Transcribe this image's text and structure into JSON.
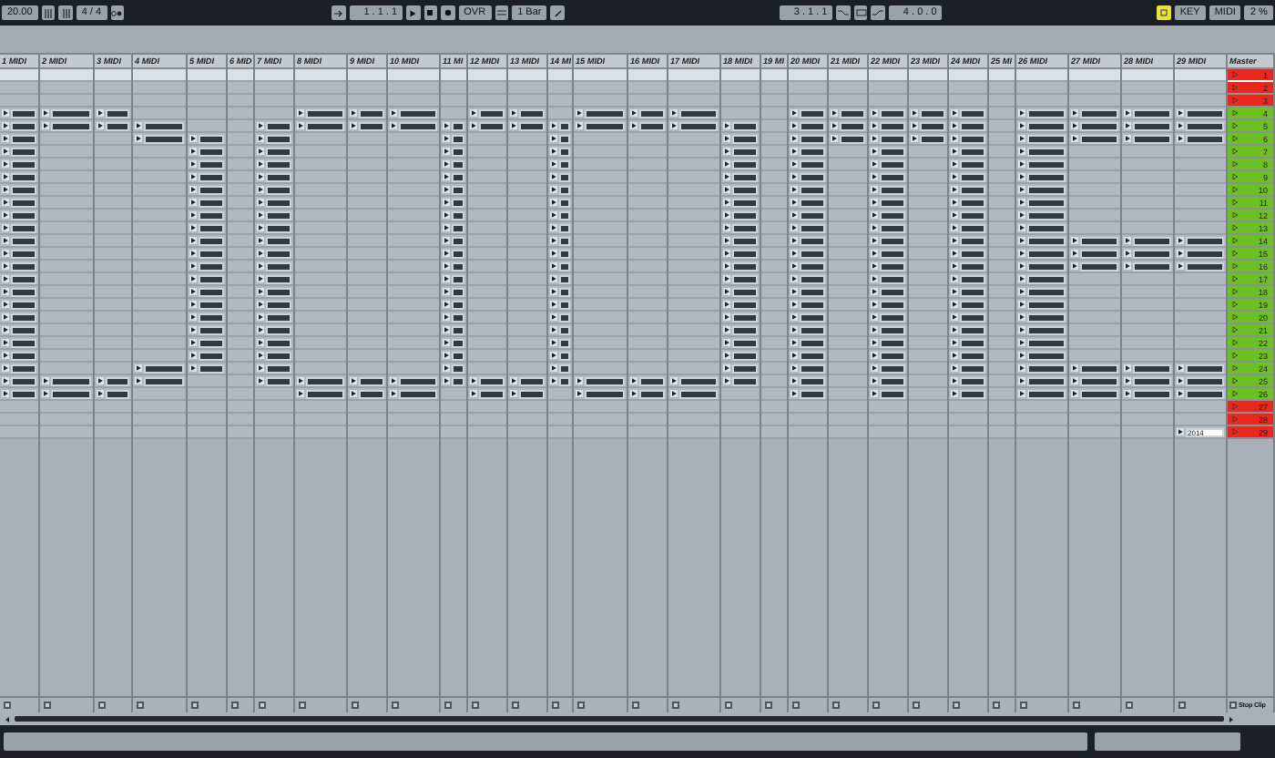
{
  "transport": {
    "tempo": "20.00",
    "time_signature": "4 / 4",
    "position": "1 . 1 . 1",
    "overdub": "OVR",
    "quantize": "1 Bar",
    "loop_start": "3 . 1 . 1",
    "loop_length": "4 . 0 . 0",
    "key": "KEY",
    "midi": "MIDI",
    "cpu": "2 %"
  },
  "tracks": [
    {
      "name": "1 MIDI",
      "clip_slots": [
        false,
        false,
        false,
        true,
        true,
        true,
        true,
        true,
        true,
        true,
        true,
        true,
        true,
        true,
        true,
        true,
        true,
        true,
        true,
        true,
        true,
        true,
        true,
        true,
        true,
        true,
        false,
        false,
        false
      ]
    },
    {
      "name": "2 MIDI",
      "clip_slots": [
        false,
        false,
        false,
        true,
        true,
        false,
        false,
        false,
        false,
        false,
        false,
        false,
        false,
        false,
        false,
        false,
        false,
        false,
        false,
        false,
        false,
        false,
        false,
        false,
        true,
        true,
        false,
        false,
        false
      ]
    },
    {
      "name": "3 MIDI",
      "clip_slots": [
        false,
        false,
        false,
        true,
        true,
        false,
        false,
        false,
        false,
        false,
        false,
        false,
        false,
        false,
        false,
        false,
        false,
        false,
        false,
        false,
        false,
        false,
        false,
        false,
        true,
        true,
        false,
        false,
        false
      ]
    },
    {
      "name": "4 MIDI",
      "clip_slots": [
        false,
        false,
        false,
        false,
        true,
        true,
        false,
        false,
        false,
        false,
        false,
        false,
        false,
        false,
        false,
        false,
        false,
        false,
        false,
        false,
        false,
        false,
        false,
        true,
        true,
        false,
        false,
        false,
        false
      ]
    },
    {
      "name": "5 MIDI",
      "clip_slots": [
        false,
        false,
        false,
        false,
        false,
        true,
        true,
        true,
        true,
        true,
        true,
        true,
        true,
        true,
        true,
        true,
        true,
        true,
        true,
        true,
        true,
        true,
        true,
        true,
        false,
        false,
        false,
        false,
        false
      ]
    },
    {
      "name": "6 MID",
      "clip_slots": [
        false,
        false,
        false,
        false,
        false,
        false,
        false,
        false,
        false,
        false,
        false,
        false,
        false,
        false,
        false,
        false,
        false,
        false,
        false,
        false,
        false,
        false,
        false,
        false,
        false,
        false,
        false,
        false,
        false
      ]
    },
    {
      "name": "7 MIDI",
      "clip_slots": [
        false,
        false,
        false,
        false,
        true,
        true,
        true,
        true,
        true,
        true,
        true,
        true,
        true,
        true,
        true,
        true,
        true,
        true,
        true,
        true,
        true,
        true,
        true,
        true,
        true,
        false,
        false,
        false,
        false
      ]
    },
    {
      "name": "8 MIDI",
      "clip_slots": [
        false,
        false,
        false,
        true,
        true,
        false,
        false,
        false,
        false,
        false,
        false,
        false,
        false,
        false,
        false,
        false,
        false,
        false,
        false,
        false,
        false,
        false,
        false,
        false,
        true,
        true,
        false,
        false,
        false
      ]
    },
    {
      "name": "9 MIDI",
      "clip_slots": [
        false,
        false,
        false,
        true,
        true,
        false,
        false,
        false,
        false,
        false,
        false,
        false,
        false,
        false,
        false,
        false,
        false,
        false,
        false,
        false,
        false,
        false,
        false,
        false,
        true,
        true,
        false,
        false,
        false
      ]
    },
    {
      "name": "10 MIDI",
      "clip_slots": [
        false,
        false,
        false,
        true,
        true,
        false,
        false,
        false,
        false,
        false,
        false,
        false,
        false,
        false,
        false,
        false,
        false,
        false,
        false,
        false,
        false,
        false,
        false,
        false,
        true,
        true,
        false,
        false,
        false
      ]
    },
    {
      "name": "11 MI",
      "clip_slots": [
        false,
        false,
        false,
        false,
        true,
        true,
        true,
        true,
        true,
        true,
        true,
        true,
        true,
        true,
        true,
        true,
        true,
        true,
        true,
        true,
        true,
        true,
        true,
        true,
        true,
        false,
        false,
        false,
        false
      ]
    },
    {
      "name": "12 MIDI",
      "clip_slots": [
        false,
        false,
        false,
        true,
        true,
        false,
        false,
        false,
        false,
        false,
        false,
        false,
        false,
        false,
        false,
        false,
        false,
        false,
        false,
        false,
        false,
        false,
        false,
        false,
        true,
        true,
        false,
        false,
        false
      ]
    },
    {
      "name": "13 MIDI",
      "clip_slots": [
        false,
        false,
        false,
        true,
        true,
        false,
        false,
        false,
        false,
        false,
        false,
        false,
        false,
        false,
        false,
        false,
        false,
        false,
        false,
        false,
        false,
        false,
        false,
        false,
        true,
        true,
        false,
        false,
        false
      ]
    },
    {
      "name": "14 MI",
      "clip_slots": [
        false,
        false,
        false,
        false,
        true,
        true,
        true,
        true,
        true,
        true,
        true,
        true,
        true,
        true,
        true,
        true,
        true,
        true,
        true,
        true,
        true,
        true,
        true,
        true,
        true,
        false,
        false,
        false,
        false
      ]
    },
    {
      "name": "15 MIDI",
      "clip_slots": [
        false,
        false,
        false,
        true,
        true,
        false,
        false,
        false,
        false,
        false,
        false,
        false,
        false,
        false,
        false,
        false,
        false,
        false,
        false,
        false,
        false,
        false,
        false,
        false,
        true,
        true,
        false,
        false,
        false
      ]
    },
    {
      "name": "16 MIDI",
      "clip_slots": [
        false,
        false,
        false,
        true,
        true,
        false,
        false,
        false,
        false,
        false,
        false,
        false,
        false,
        false,
        false,
        false,
        false,
        false,
        false,
        false,
        false,
        false,
        false,
        false,
        true,
        true,
        false,
        false,
        false
      ]
    },
    {
      "name": "17 MIDI",
      "clip_slots": [
        false,
        false,
        false,
        true,
        true,
        false,
        false,
        false,
        false,
        false,
        false,
        false,
        false,
        false,
        false,
        false,
        false,
        false,
        false,
        false,
        false,
        false,
        false,
        false,
        true,
        true,
        false,
        false,
        false
      ]
    },
    {
      "name": "18 MIDI",
      "clip_slots": [
        false,
        false,
        false,
        false,
        true,
        true,
        true,
        true,
        true,
        true,
        true,
        true,
        true,
        true,
        true,
        true,
        true,
        true,
        true,
        true,
        true,
        true,
        true,
        true,
        true,
        false,
        false,
        false,
        false
      ]
    },
    {
      "name": "19 MI",
      "clip_slots": [
        false,
        false,
        false,
        false,
        false,
        false,
        false,
        false,
        false,
        false,
        false,
        false,
        false,
        false,
        false,
        false,
        false,
        false,
        false,
        false,
        false,
        false,
        false,
        false,
        false,
        false,
        false,
        false,
        false
      ]
    },
    {
      "name": "20 MIDI",
      "clip_slots": [
        false,
        false,
        false,
        true,
        true,
        true,
        true,
        true,
        true,
        true,
        true,
        true,
        true,
        true,
        true,
        true,
        true,
        true,
        true,
        true,
        true,
        true,
        true,
        true,
        true,
        true,
        false,
        false,
        false
      ]
    },
    {
      "name": "21 MIDI",
      "clip_slots": [
        false,
        false,
        false,
        true,
        true,
        true,
        false,
        false,
        false,
        false,
        false,
        false,
        false,
        false,
        false,
        false,
        false,
        false,
        false,
        false,
        false,
        false,
        false,
        false,
        false,
        false,
        false,
        false,
        false
      ]
    },
    {
      "name": "22 MIDI",
      "clip_slots": [
        false,
        false,
        false,
        true,
        true,
        true,
        true,
        true,
        true,
        true,
        true,
        true,
        true,
        true,
        true,
        true,
        true,
        true,
        true,
        true,
        true,
        true,
        true,
        true,
        true,
        true,
        false,
        false,
        false
      ]
    },
    {
      "name": "23 MIDI",
      "clip_slots": [
        false,
        false,
        false,
        true,
        true,
        true,
        false,
        false,
        false,
        false,
        false,
        false,
        false,
        false,
        false,
        false,
        false,
        false,
        false,
        false,
        false,
        false,
        false,
        false,
        false,
        false,
        false,
        false,
        false
      ]
    },
    {
      "name": "24 MIDI",
      "clip_slots": [
        false,
        false,
        false,
        true,
        true,
        true,
        true,
        true,
        true,
        true,
        true,
        true,
        true,
        true,
        true,
        true,
        true,
        true,
        true,
        true,
        true,
        true,
        true,
        true,
        true,
        true,
        false,
        false,
        false
      ]
    },
    {
      "name": "25 MI",
      "clip_slots": [
        false,
        false,
        false,
        false,
        false,
        false,
        false,
        false,
        false,
        false,
        false,
        false,
        false,
        false,
        false,
        false,
        false,
        false,
        false,
        false,
        false,
        false,
        false,
        false,
        false,
        false,
        false,
        false,
        false
      ]
    },
    {
      "name": "26 MIDI",
      "clip_slots": [
        false,
        false,
        false,
        true,
        true,
        true,
        true,
        true,
        true,
        true,
        true,
        true,
        true,
        true,
        true,
        true,
        true,
        true,
        true,
        true,
        true,
        true,
        true,
        true,
        true,
        true,
        false,
        false,
        false
      ]
    },
    {
      "name": "27 MIDI",
      "clip_slots": [
        false,
        false,
        false,
        true,
        true,
        true,
        false,
        false,
        false,
        false,
        false,
        false,
        false,
        true,
        true,
        true,
        false,
        false,
        false,
        false,
        false,
        false,
        false,
        true,
        true,
        true,
        false,
        false,
        false
      ]
    },
    {
      "name": "28 MIDI",
      "clip_slots": [
        false,
        false,
        false,
        true,
        true,
        true,
        false,
        false,
        false,
        false,
        false,
        false,
        false,
        true,
        true,
        true,
        false,
        false,
        false,
        false,
        false,
        false,
        false,
        true,
        true,
        true,
        false,
        false,
        false
      ]
    },
    {
      "name": "29 MIDI",
      "clip_slots": [
        false,
        false,
        false,
        true,
        true,
        true,
        false,
        false,
        false,
        false,
        false,
        false,
        false,
        true,
        true,
        true,
        false,
        false,
        false,
        false,
        false,
        false,
        false,
        true,
        true,
        true,
        false,
        false,
        "2014"
      ]
    }
  ],
  "master": {
    "name": "Master",
    "stop_label": "Stop Clip"
  },
  "scenes": [
    {
      "label": "1",
      "color": "#e8281e",
      "selected": true
    },
    {
      "label": "2",
      "color": "#e8281e",
      "selected": false
    },
    {
      "label": "3",
      "color": "#e8281e",
      "selected": false
    },
    {
      "label": "4",
      "color": "#6cc024",
      "selected": false
    },
    {
      "label": "5",
      "color": "#6cc024",
      "selected": false
    },
    {
      "label": "6",
      "color": "#6cc024",
      "selected": false
    },
    {
      "label": "7",
      "color": "#6cc024",
      "selected": false
    },
    {
      "label": "8",
      "color": "#6cc024",
      "selected": false
    },
    {
      "label": "9",
      "color": "#6cc024",
      "selected": false
    },
    {
      "label": "10",
      "color": "#6cc024",
      "selected": false
    },
    {
      "label": "11",
      "color": "#6cc024",
      "selected": false
    },
    {
      "label": "12",
      "color": "#6cc024",
      "selected": false
    },
    {
      "label": "13",
      "color": "#6cc024",
      "selected": false
    },
    {
      "label": "14",
      "color": "#6cc024",
      "selected": false
    },
    {
      "label": "15",
      "color": "#6cc024",
      "selected": false
    },
    {
      "label": "16",
      "color": "#6cc024",
      "selected": false
    },
    {
      "label": "17",
      "color": "#6cc024",
      "selected": false
    },
    {
      "label": "18",
      "color": "#6cc024",
      "selected": false
    },
    {
      "label": "19",
      "color": "#6cc024",
      "selected": false
    },
    {
      "label": "20",
      "color": "#6cc024",
      "selected": false
    },
    {
      "label": "21",
      "color": "#6cc024",
      "selected": false
    },
    {
      "label": "22",
      "color": "#6cc024",
      "selected": false
    },
    {
      "label": "23",
      "color": "#6cc024",
      "selected": false
    },
    {
      "label": "24",
      "color": "#6cc024",
      "selected": false
    },
    {
      "label": "25",
      "color": "#6cc024",
      "selected": false
    },
    {
      "label": "26",
      "color": "#6cc024",
      "selected": false
    },
    {
      "label": "27",
      "color": "#e8281e",
      "selected": false
    },
    {
      "label": "28",
      "color": "#e8281e",
      "selected": false
    },
    {
      "label": "29",
      "color": "#e8281e",
      "selected": false
    }
  ]
}
